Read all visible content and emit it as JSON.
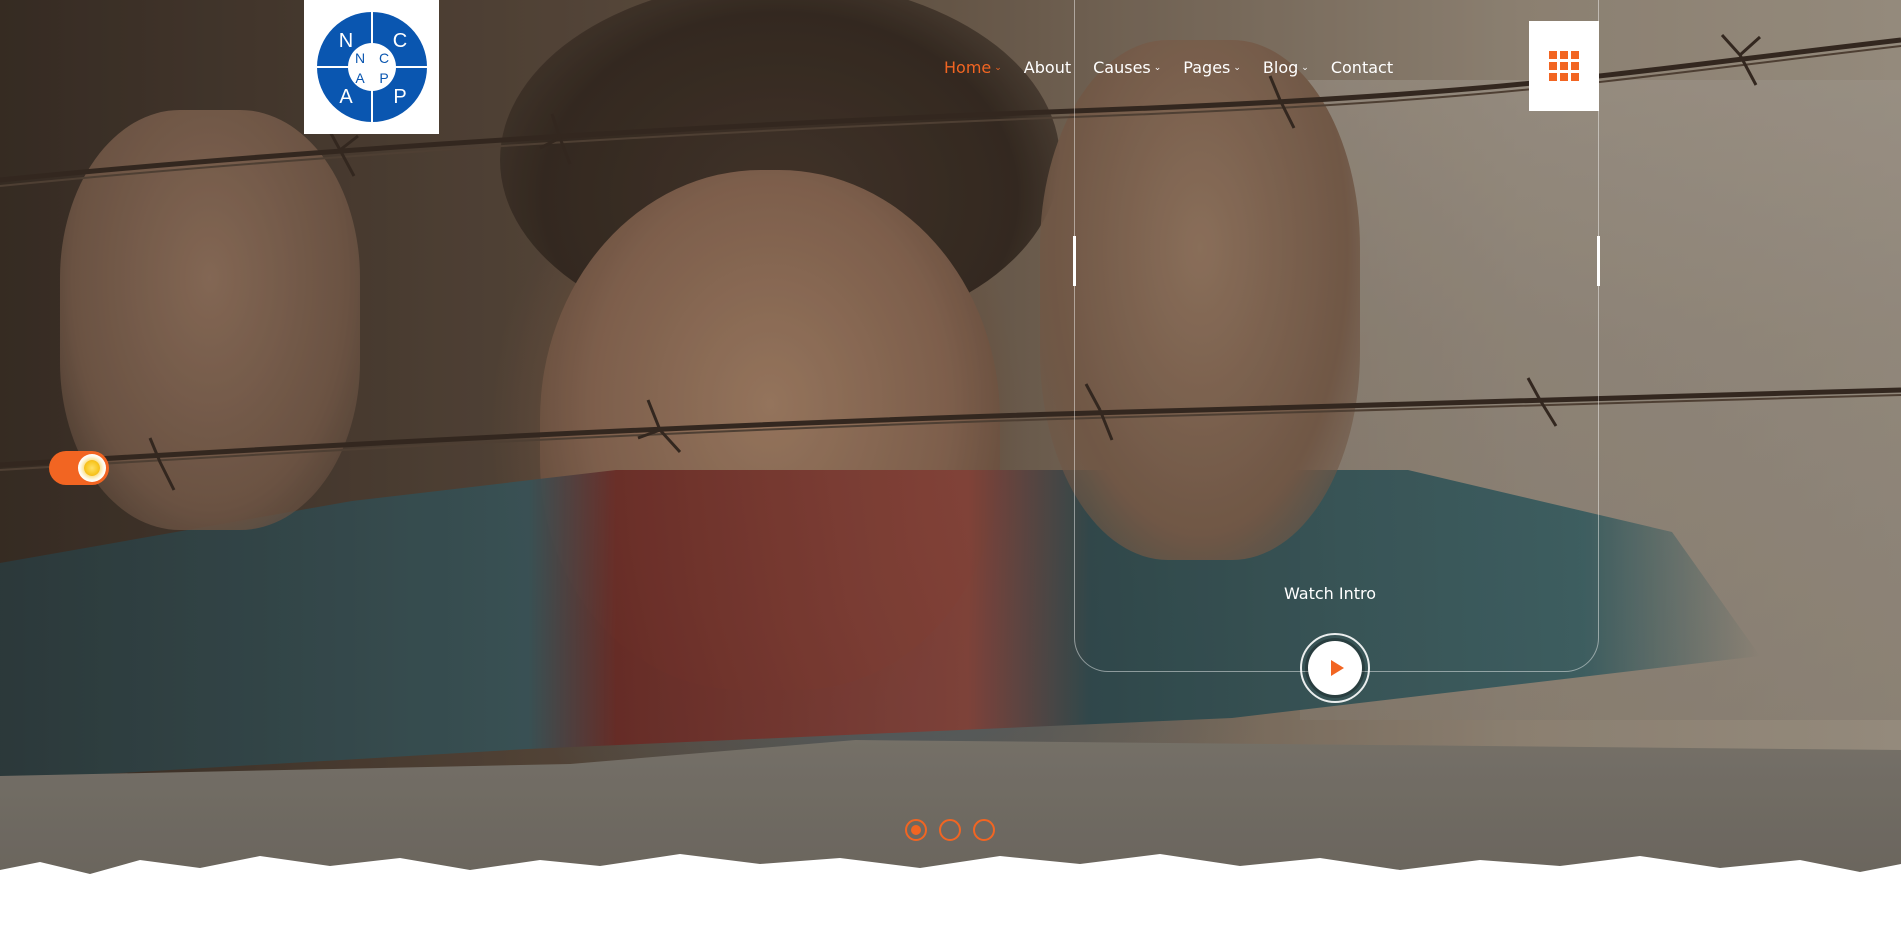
{
  "logo": {
    "letters": {
      "top_left": "N",
      "top_right": "C",
      "bottom_left": "A",
      "bottom_right": "P",
      "center_top_left": "N",
      "center_top_right": "C",
      "center_bottom_left": "A",
      "center_bottom_right": "P"
    }
  },
  "nav": {
    "items": [
      {
        "label": "Home",
        "has_dropdown": true,
        "active": true
      },
      {
        "label": "About",
        "has_dropdown": false,
        "active": false
      },
      {
        "label": "Causes",
        "has_dropdown": true,
        "active": false
      },
      {
        "label": "Pages",
        "has_dropdown": true,
        "active": false
      },
      {
        "label": "Blog",
        "has_dropdown": true,
        "active": false
      },
      {
        "label": "Contact",
        "has_dropdown": false,
        "active": false
      }
    ],
    "dropdown_glyph": "⌄"
  },
  "menu_button": {
    "icon": "grid-icon"
  },
  "hero": {
    "watch_label": "Watch Intro",
    "play_icon": "play-icon"
  },
  "theme_toggle": {
    "icon": "sun-icon",
    "state": "on"
  },
  "slider": {
    "count": 3,
    "active_index": 0
  },
  "colors": {
    "accent": "#f26522",
    "logo_blue": "#0a56b0",
    "white": "#ffffff"
  }
}
